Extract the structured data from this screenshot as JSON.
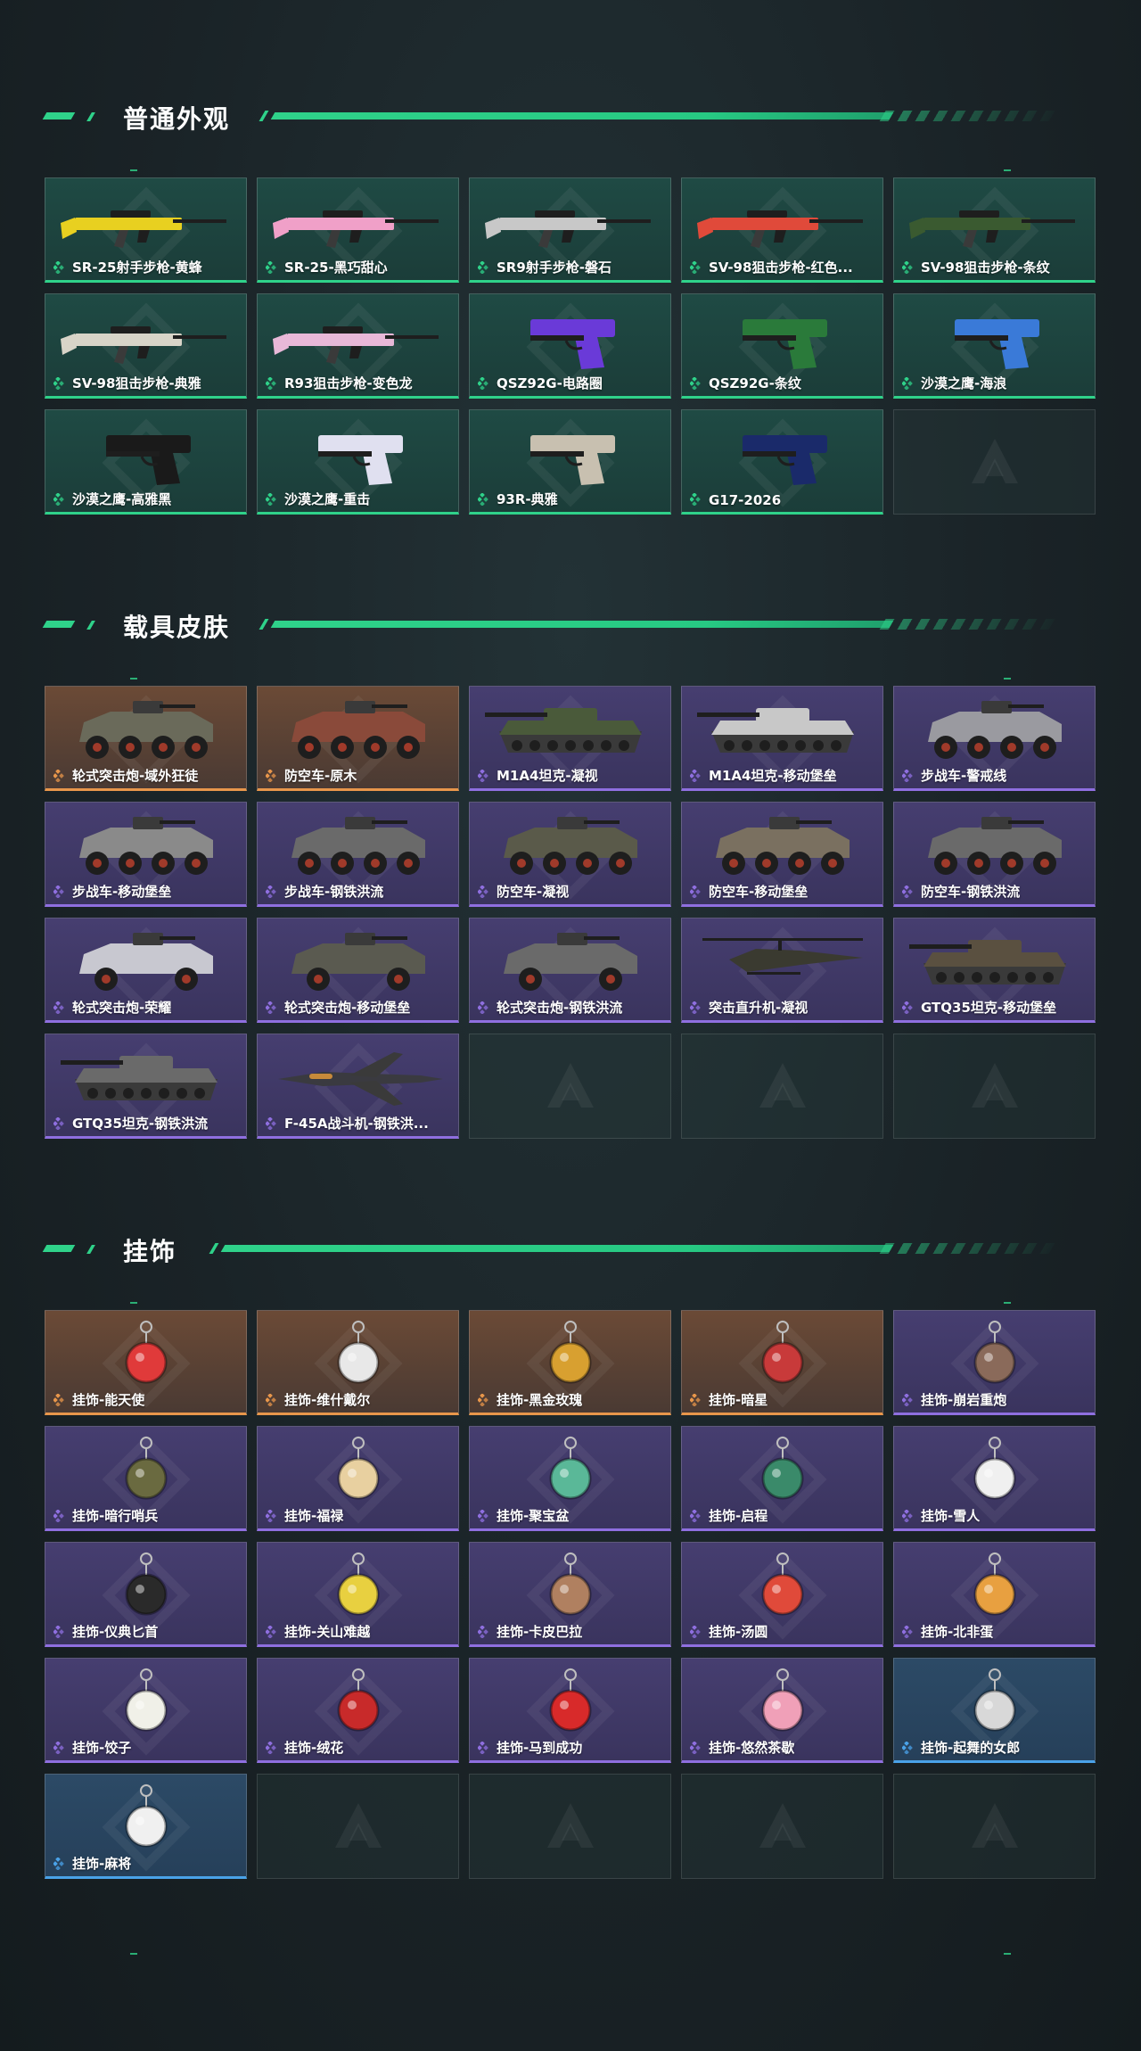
{
  "sections": [
    {
      "title": "普通外观",
      "items": [
        {
          "label": "SR-25射手步枪-黄蜂",
          "rarity": "green",
          "art": "rifle",
          "color": "#e8d020"
        },
        {
          "label": "SR-25-黑巧甜心",
          "rarity": "green",
          "art": "rifle",
          "color": "#f0a0c8"
        },
        {
          "label": "SR9射手步枪-磐石",
          "rarity": "green",
          "art": "rifle",
          "color": "#c8c8c8"
        },
        {
          "label": "SV-98狙击步枪-红色...",
          "rarity": "green",
          "art": "rifle",
          "color": "#e04a3a"
        },
        {
          "label": "SV-98狙击步枪-条纹",
          "rarity": "green",
          "art": "rifle",
          "color": "#3a5a30"
        },
        {
          "label": "SV-98狙击步枪-典雅",
          "rarity": "green",
          "art": "rifle",
          "color": "#d8d4c8"
        },
        {
          "label": "R93狙击步枪-变色龙",
          "rarity": "green",
          "art": "rifle",
          "color": "#e8b8d8"
        },
        {
          "label": "QSZ92G-电路圈",
          "rarity": "green",
          "art": "pistol",
          "color": "#6a3ad8"
        },
        {
          "label": "QSZ92G-条纹",
          "rarity": "green",
          "art": "pistol",
          "color": "#2a7a3a"
        },
        {
          "label": "沙漠之鹰-海浪",
          "rarity": "green",
          "art": "pistol",
          "color": "#3a7ad8"
        },
        {
          "label": "沙漠之鹰-高雅黑",
          "rarity": "green",
          "art": "pistol",
          "color": "#1a1a1a"
        },
        {
          "label": "沙漠之鹰-重击",
          "rarity": "green",
          "art": "pistol",
          "color": "#e0e0f0"
        },
        {
          "label": "93R-典雅",
          "rarity": "green",
          "art": "pistol",
          "color": "#c8c0b0"
        },
        {
          "label": "G17-2026",
          "rarity": "green",
          "art": "pistol",
          "color": "#1a2a6a"
        },
        {
          "label": "",
          "rarity": "empty"
        }
      ]
    },
    {
      "title": "载具皮肤",
      "items": [
        {
          "label": "轮式突击炮-域外狂徒",
          "rarity": "orange",
          "art": "vehicle",
          "color": "#6a6a5a"
        },
        {
          "label": "防空车-原木",
          "rarity": "orange",
          "art": "vehicle",
          "color": "#8a4a3a"
        },
        {
          "label": "M1A4坦克-凝视",
          "rarity": "purple",
          "art": "tank",
          "color": "#4a5a3a"
        },
        {
          "label": "M1A4坦克-移动堡垒",
          "rarity": "purple",
          "art": "tank",
          "color": "#c8c8c8"
        },
        {
          "label": "步战车-警戒线",
          "rarity": "purple",
          "art": "vehicle",
          "color": "#9a9aa0"
        },
        {
          "label": "步战车-移动堡垒",
          "rarity": "purple",
          "art": "vehicle",
          "color": "#8a8a8a"
        },
        {
          "label": "步战车-钢铁洪流",
          "rarity": "purple",
          "art": "vehicle",
          "color": "#6a6a6a"
        },
        {
          "label": "防空车-凝视",
          "rarity": "purple",
          "art": "vehicle",
          "color": "#5a5a4a"
        },
        {
          "label": "防空车-移动堡垒",
          "rarity": "purple",
          "art": "vehicle",
          "color": "#7a7060"
        },
        {
          "label": "防空车-钢铁洪流",
          "rarity": "purple",
          "art": "vehicle",
          "color": "#6a6a6a"
        },
        {
          "label": "轮式突击炮-荣耀",
          "rarity": "purple",
          "art": "buggy",
          "color": "#c8c8d0"
        },
        {
          "label": "轮式突击炮-移动堡垒",
          "rarity": "purple",
          "art": "buggy",
          "color": "#5a5a50"
        },
        {
          "label": "轮式突击炮-钢铁洪流",
          "rarity": "purple",
          "art": "buggy",
          "color": "#6a6a6a"
        },
        {
          "label": "突击直升机-凝视",
          "rarity": "purple",
          "art": "heli",
          "color": "#3a3a30"
        },
        {
          "label": "GTQ35坦克-移动堡垒",
          "rarity": "purple",
          "art": "tank",
          "color": "#5a5040"
        },
        {
          "label": "GTQ35坦克-钢铁洪流",
          "rarity": "purple",
          "art": "tank",
          "color": "#6a6a6a"
        },
        {
          "label": "F-45A战斗机-钢铁洪...",
          "rarity": "purple",
          "art": "jet",
          "color": "#3a3a40"
        },
        {
          "label": "",
          "rarity": "empty"
        },
        {
          "label": "",
          "rarity": "empty"
        },
        {
          "label": "",
          "rarity": "empty"
        }
      ]
    },
    {
      "title": "挂饰",
      "items": [
        {
          "label": "挂饰-能天使",
          "rarity": "orange",
          "art": "charm",
          "color": "#e03a3a"
        },
        {
          "label": "挂饰-维什戴尔",
          "rarity": "orange",
          "art": "charm",
          "color": "#e8e8e8"
        },
        {
          "label": "挂饰-黑金玫瑰",
          "rarity": "orange",
          "art": "charm",
          "color": "#d8a030"
        },
        {
          "label": "挂饰-暗星",
          "rarity": "orange",
          "art": "charm",
          "color": "#c83a3a"
        },
        {
          "label": "挂饰-崩岩重炮",
          "rarity": "purple",
          "art": "charm",
          "color": "#8a6a5a"
        },
        {
          "label": "挂饰-暗行哨兵",
          "rarity": "purple",
          "art": "charm",
          "color": "#6a6a40"
        },
        {
          "label": "挂饰-福禄",
          "rarity": "purple",
          "art": "charm",
          "color": "#e8d0a0"
        },
        {
          "label": "挂饰-聚宝盆",
          "rarity": "purple",
          "art": "charm",
          "color": "#5ab898"
        },
        {
          "label": "挂饰-启程",
          "rarity": "purple",
          "art": "charm",
          "color": "#3a8a6a"
        },
        {
          "label": "挂饰-雪人",
          "rarity": "purple",
          "art": "charm",
          "color": "#f0f0f0"
        },
        {
          "label": "挂饰-仪典匕首",
          "rarity": "purple",
          "art": "charm",
          "color": "#2a2a2a"
        },
        {
          "label": "挂饰-关山难越",
          "rarity": "purple",
          "art": "charm",
          "color": "#e8d040"
        },
        {
          "label": "挂饰-卡皮巴拉",
          "rarity": "purple",
          "art": "charm",
          "color": "#b08060"
        },
        {
          "label": "挂饰-汤圆",
          "rarity": "purple",
          "art": "charm",
          "color": "#e04a3a"
        },
        {
          "label": "挂饰-北非蛋",
          "rarity": "purple",
          "art": "charm",
          "color": "#e8a040"
        },
        {
          "label": "挂饰-饺子",
          "rarity": "purple",
          "art": "charm",
          "color": "#f0f0e8"
        },
        {
          "label": "挂饰-绒花",
          "rarity": "purple",
          "art": "charm",
          "color": "#c82a2a"
        },
        {
          "label": "挂饰-马到成功",
          "rarity": "purple",
          "art": "charm",
          "color": "#d82a2a"
        },
        {
          "label": "挂饰-悠然茶歇",
          "rarity": "purple",
          "art": "charm",
          "color": "#f0a0b8"
        },
        {
          "label": "挂饰-起舞的女郎",
          "rarity": "blue",
          "art": "charm",
          "color": "#d8d8d8"
        },
        {
          "label": "挂饰-麻将",
          "rarity": "blue",
          "art": "charm",
          "color": "#f0f0f0"
        },
        {
          "label": "",
          "rarity": "empty"
        },
        {
          "label": "",
          "rarity": "empty"
        },
        {
          "label": "",
          "rarity": "empty"
        },
        {
          "label": "",
          "rarity": "empty"
        }
      ]
    }
  ],
  "colors": {
    "accent": "#2fd28a",
    "rarity_green": "#2fd28a",
    "rarity_orange": "#e8964b",
    "rarity_purple": "#8f6fe0",
    "rarity_blue": "#4aa2e8"
  }
}
